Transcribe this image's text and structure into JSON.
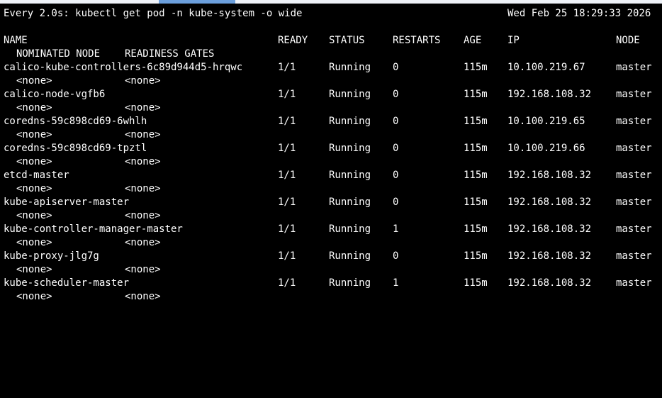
{
  "terminal": {
    "watch_header": "Every 2.0s: kubectl get pod -n kube-system -o wide",
    "datetime": "Wed Feb 25 18:29:33 2026",
    "headers": {
      "name": "NAME",
      "ready": "READY",
      "status": "STATUS",
      "restarts": "RESTARTS",
      "age": "AGE",
      "ip": "IP",
      "node": "NODE",
      "nominated_node": "NOMINATED NODE",
      "readiness_gates": "READINESS GATES"
    },
    "pods": [
      {
        "name": "calico-kube-controllers-6c89d944d5-hrqwc",
        "ready": "1/1",
        "status": "Running",
        "restarts": "0",
        "age": "115m",
        "ip": "10.100.219.67",
        "node": "master",
        "nominated_node": "<none>",
        "readiness_gates": "<none>"
      },
      {
        "name": "calico-node-vgfb6",
        "ready": "1/1",
        "status": "Running",
        "restarts": "0",
        "age": "115m",
        "ip": "192.168.108.32",
        "node": "master",
        "nominated_node": "<none>",
        "readiness_gates": "<none>"
      },
      {
        "name": "coredns-59c898cd69-6whlh",
        "ready": "1/1",
        "status": "Running",
        "restarts": "0",
        "age": "115m",
        "ip": "10.100.219.65",
        "node": "master",
        "nominated_node": "<none>",
        "readiness_gates": "<none>"
      },
      {
        "name": "coredns-59c898cd69-tpztl",
        "ready": "1/1",
        "status": "Running",
        "restarts": "0",
        "age": "115m",
        "ip": "10.100.219.66",
        "node": "master",
        "nominated_node": "<none>",
        "readiness_gates": "<none>"
      },
      {
        "name": "etcd-master",
        "ready": "1/1",
        "status": "Running",
        "restarts": "0",
        "age": "115m",
        "ip": "192.168.108.32",
        "node": "master",
        "nominated_node": "<none>",
        "readiness_gates": "<none>"
      },
      {
        "name": "kube-apiserver-master",
        "ready": "1/1",
        "status": "Running",
        "restarts": "0",
        "age": "115m",
        "ip": "192.168.108.32",
        "node": "master",
        "nominated_node": "<none>",
        "readiness_gates": "<none>"
      },
      {
        "name": "kube-controller-manager-master",
        "ready": "1/1",
        "status": "Running",
        "restarts": "1",
        "age": "115m",
        "ip": "192.168.108.32",
        "node": "master",
        "nominated_node": "<none>",
        "readiness_gates": "<none>"
      },
      {
        "name": "kube-proxy-jlg7g",
        "ready": "1/1",
        "status": "Running",
        "restarts": "0",
        "age": "115m",
        "ip": "192.168.108.32",
        "node": "master",
        "nominated_node": "<none>",
        "readiness_gates": "<none>"
      },
      {
        "name": "kube-scheduler-master",
        "ready": "1/1",
        "status": "Running",
        "restarts": "1",
        "age": "115m",
        "ip": "192.168.108.32",
        "node": "master",
        "nominated_node": "<none>",
        "readiness_gates": "<none>"
      }
    ]
  },
  "colors": {
    "background": "#000000",
    "foreground": "#ffffff",
    "top_bar": "#eef2f8",
    "top_bar_tab": "#6b9fdc"
  }
}
